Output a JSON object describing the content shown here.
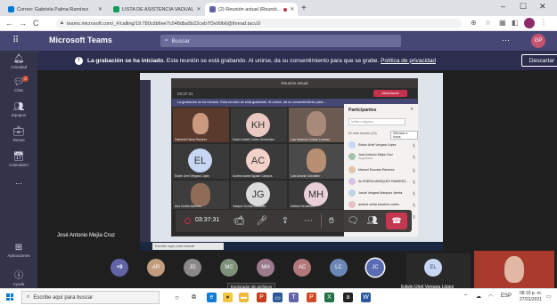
{
  "browser": {
    "tabs": [
      {
        "label": "Correo: Gabriela Palma Ramírez",
        "favicon_color": "#0078d4"
      },
      {
        "label": "LISTA DE ASISTENCIA VADUAL",
        "favicon_color": "#0f9d58"
      },
      {
        "label": "(2) Reunión actual (Reunió...",
        "favicon_color": "#6264a7"
      }
    ],
    "url": "teams.microsoft.com/_#/calling/19:780cdb6ee7c048dba5b22ceb7f3e99b6@thread.tacv2/"
  },
  "teams": {
    "app_title": "Microsoft Teams",
    "search_placeholder": "Buscar",
    "user_initials": "GP",
    "rail": [
      {
        "label": "Actividad",
        "icon": "bell-icon"
      },
      {
        "label": "Chat",
        "icon": "chat-icon",
        "badge": "2"
      },
      {
        "label": "Equipos",
        "icon": "teams-icon"
      },
      {
        "label": "Tareas",
        "icon": "tasks-icon"
      },
      {
        "label": "Calendario",
        "icon": "calendar-icon"
      },
      {
        "label": "...",
        "icon": "more-icon"
      },
      {
        "label": "Aplicaciones",
        "icon": "apps-icon"
      },
      {
        "label": "Ayuda",
        "icon": "help-icon"
      }
    ]
  },
  "recording": {
    "bold": "La grabación se ha iniciado.",
    "text": " Esta reunión se está grabando. Al unirse, da su consentimiento para que se grabe. ",
    "link": "Política de privacidad",
    "discard_label": "Descartar"
  },
  "shared_screen": {
    "window_title": "Reunión actual",
    "timer_small": "03:37:31",
    "leave_label": "Abandonar",
    "banner": "La grabación se ha iniciado.  Esta reunión se está grabando. Al unirse, da su consentimiento para...",
    "tiles": [
      {
        "name": "Gabriela Palma Ramírez",
        "initials": "",
        "bg": "#5b3a2e"
      },
      {
        "name": "Karla Lizbeth Cortes Hernández",
        "initials": "KH",
        "bg": "#e9c9c1"
      },
      {
        "name": "Luis Norberto Cobian Lorenzo",
        "initials": "",
        "bg": "#6a5a52"
      },
      {
        "name": "Edwin Uriel Vergara López",
        "initials": "EL",
        "bg": "#c7d6f2"
      },
      {
        "name": "Andrea Isabel Aguilar Campos",
        "initials": "AC",
        "bg": "#f2d1c9"
      },
      {
        "name": "Luis Antonio Gonzalez",
        "initials": "",
        "bg": "#4a4a4a"
      },
      {
        "name": "Ana Cecilia Martínez",
        "initials": "",
        "bg": "#3d3d3d"
      },
      {
        "name": "Joaquín Ochoa González",
        "initials": "JG",
        "bg": "#dcdcdc"
      },
      {
        "name": "Marisol Hernández",
        "initials": "MH",
        "bg": "#e8cfd8"
      }
    ],
    "search_text": "Escribe aquí para buscar",
    "panel": {
      "title": "Participantes",
      "invite_placeholder": "Invitar a alguien",
      "section": "En esta reunión (29)",
      "mute_all": "Silenciar a todos",
      "people": [
        {
          "name": "Edwin Uriel Vergara López",
          "sub": "",
          "color": "#c7d6f2"
        },
        {
          "name": "José Antonio Mejía Cruz",
          "sub": "Organizador",
          "color": "#a7c2a7"
        },
        {
          "name": "Manuel Escobar Ramírez",
          "sub": "",
          "color": "#e3c4a6"
        },
        {
          "name": "ALONDRA MÁRQUEZ RAMÍREZ...",
          "sub": "",
          "color": "#d6c2e6"
        },
        {
          "name": "Josué Vergara Márquez Varela",
          "sub": "",
          "color": "#bcd4e6"
        },
        {
          "name": "andrea ceida sanchez cortes",
          "sub": "",
          "color": "#e6c2c2"
        },
        {
          "name": "Anthony Garcia",
          "sub": "",
          "color": "#c9e0c2"
        }
      ]
    }
  },
  "call": {
    "elapsed": "03:37:31"
  },
  "presenter_name": "José Antonio Mejía Cruz",
  "bottom_participants": [
    {
      "label": "+9",
      "color": "#6264a7"
    },
    {
      "label": "AR",
      "color": "#c19c7d"
    },
    {
      "label": "JG",
      "color": "#8a8886"
    },
    {
      "label": "MC",
      "color": "#7e8f7a"
    },
    {
      "label": "MH",
      "color": "#9c7a8e"
    },
    {
      "label": "AC",
      "color": "#b1787a"
    },
    {
      "label": "LC",
      "color": "#6b87b6"
    },
    {
      "label": "JC",
      "color": "#5b6bb3"
    }
  ],
  "featured": {
    "initials": "EL",
    "name": "Edwin Uriel Vergara López"
  },
  "tooltip": "Explorador de archivos",
  "taskbar": {
    "search_placeholder": "Escribe aquí para buscar",
    "time": "08:19 p. m.",
    "date": "27/01/2021",
    "lang": "ESP"
  }
}
